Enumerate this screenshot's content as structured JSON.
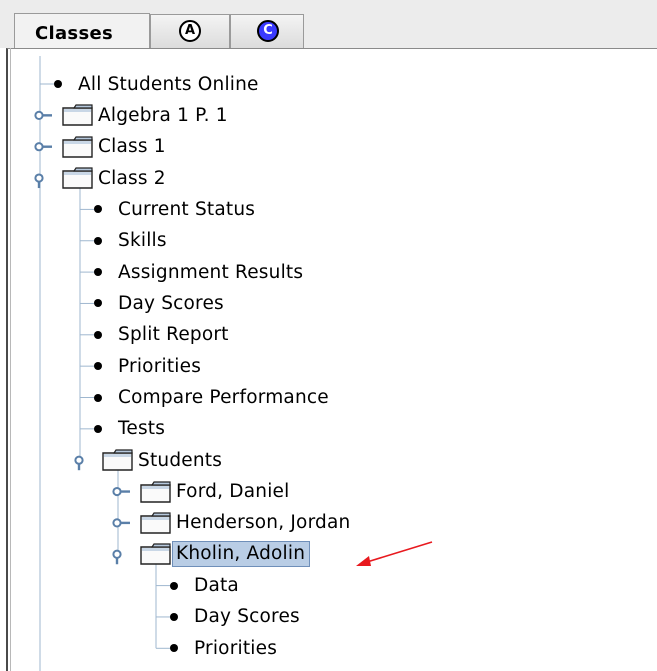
{
  "tabs": [
    {
      "label": "Classes",
      "active": true
    },
    {
      "label": "",
      "letter": "A",
      "style": "plain"
    },
    {
      "label": "",
      "letter": "C",
      "style": "blue",
      "color": "#3a3aff"
    }
  ],
  "tree": {
    "items": [
      {
        "id": "all-students-online",
        "label": "All Students Online",
        "type": "leaf",
        "depth": 0
      },
      {
        "id": "algebra-1-p-1",
        "label": "Algebra 1 P. 1",
        "type": "folder",
        "depth": 0,
        "expanded": false
      },
      {
        "id": "class-1",
        "label": "Class 1",
        "type": "folder",
        "depth": 0,
        "expanded": false
      },
      {
        "id": "class-2",
        "label": "Class 2",
        "type": "folder",
        "depth": 0,
        "expanded": true
      },
      {
        "id": "current-status",
        "label": "Current Status",
        "type": "leaf",
        "depth": 1
      },
      {
        "id": "skills",
        "label": "Skills",
        "type": "leaf",
        "depth": 1
      },
      {
        "id": "assignment-results",
        "label": "Assignment Results",
        "type": "leaf",
        "depth": 1
      },
      {
        "id": "day-scores",
        "label": "Day Scores",
        "type": "leaf",
        "depth": 1
      },
      {
        "id": "split-report",
        "label": "Split Report",
        "type": "leaf",
        "depth": 1
      },
      {
        "id": "priorities",
        "label": "Priorities",
        "type": "leaf",
        "depth": 1
      },
      {
        "id": "compare-performance",
        "label": "Compare Performance",
        "type": "leaf",
        "depth": 1
      },
      {
        "id": "tests",
        "label": "Tests",
        "type": "leaf",
        "depth": 1
      },
      {
        "id": "students",
        "label": "Students",
        "type": "folder",
        "depth": 1,
        "expanded": true
      },
      {
        "id": "ford-daniel",
        "label": "Ford, Daniel",
        "type": "folder",
        "depth": 2,
        "expanded": false
      },
      {
        "id": "henderson-jordan",
        "label": "Henderson, Jordan",
        "type": "folder",
        "depth": 2,
        "expanded": false
      },
      {
        "id": "kholin-adolin",
        "label": "Kholin, Adolin",
        "type": "folder",
        "depth": 2,
        "expanded": true,
        "selected": true
      },
      {
        "id": "data",
        "label": "Data",
        "type": "leaf",
        "depth": 3
      },
      {
        "id": "student-day-scores",
        "label": "Day Scores",
        "type": "leaf",
        "depth": 3
      },
      {
        "id": "student-priorities",
        "label": "Priorities",
        "type": "leaf",
        "depth": 3
      }
    ]
  },
  "colors": {
    "selection_bg": "#b9cde5",
    "selection_border": "#6f8fb9",
    "tree_line": "#9fb7cf",
    "expander": "#5a7fa8",
    "annotation_arrow": "#e8191e"
  }
}
